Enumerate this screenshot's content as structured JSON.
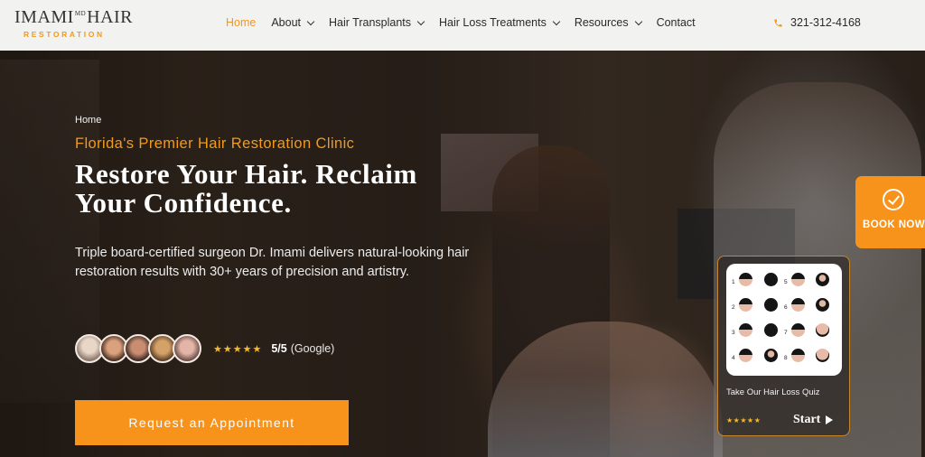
{
  "logo": {
    "name_left": "IMAMI",
    "name_md": "MD",
    "name_right": "HAIR",
    "tagline": "RESTORATION"
  },
  "nav": {
    "items": [
      {
        "label": "Home",
        "active": true,
        "dropdown": false
      },
      {
        "label": "About",
        "active": false,
        "dropdown": true
      },
      {
        "label": "Hair Transplants",
        "active": false,
        "dropdown": true
      },
      {
        "label": "Hair Loss Treatments",
        "active": false,
        "dropdown": true
      },
      {
        "label": "Resources",
        "active": false,
        "dropdown": true
      },
      {
        "label": "Contact",
        "active": false,
        "dropdown": false
      }
    ],
    "phone": "321-312-4168"
  },
  "hero": {
    "breadcrumb": "Home",
    "subtitle": "Florida's Premier Hair Restoration Clinic",
    "title": "Restore Your Hair. Reclaim Your Confidence.",
    "description": "Triple board-certified surgeon Dr. Imami delivers natural-looking hair restoration results with 30+ years of precision and artistry.",
    "rating": {
      "stars": "★★★★★",
      "score": "5/5",
      "source": "(Google)",
      "avatar_colors": [
        "#c9b9a8",
        "#b9816a",
        "#8b5d4c",
        "#a36f45",
        "#c79b8c"
      ]
    },
    "cta_label": "Request an Appointment"
  },
  "quiz": {
    "label": "Take Our Hair Loss Quiz",
    "stars": "★★★★★",
    "start_label": "Start",
    "stage_numbers": [
      "1",
      "2",
      "3",
      "4",
      "5",
      "6",
      "7",
      "8"
    ]
  },
  "book_now": {
    "label": "BOOK NOW"
  },
  "colors": {
    "accent": "#f7921a",
    "subtitle": "#f29a1b",
    "star": "#f7b92b",
    "header_bg": "#f2f2f1"
  }
}
